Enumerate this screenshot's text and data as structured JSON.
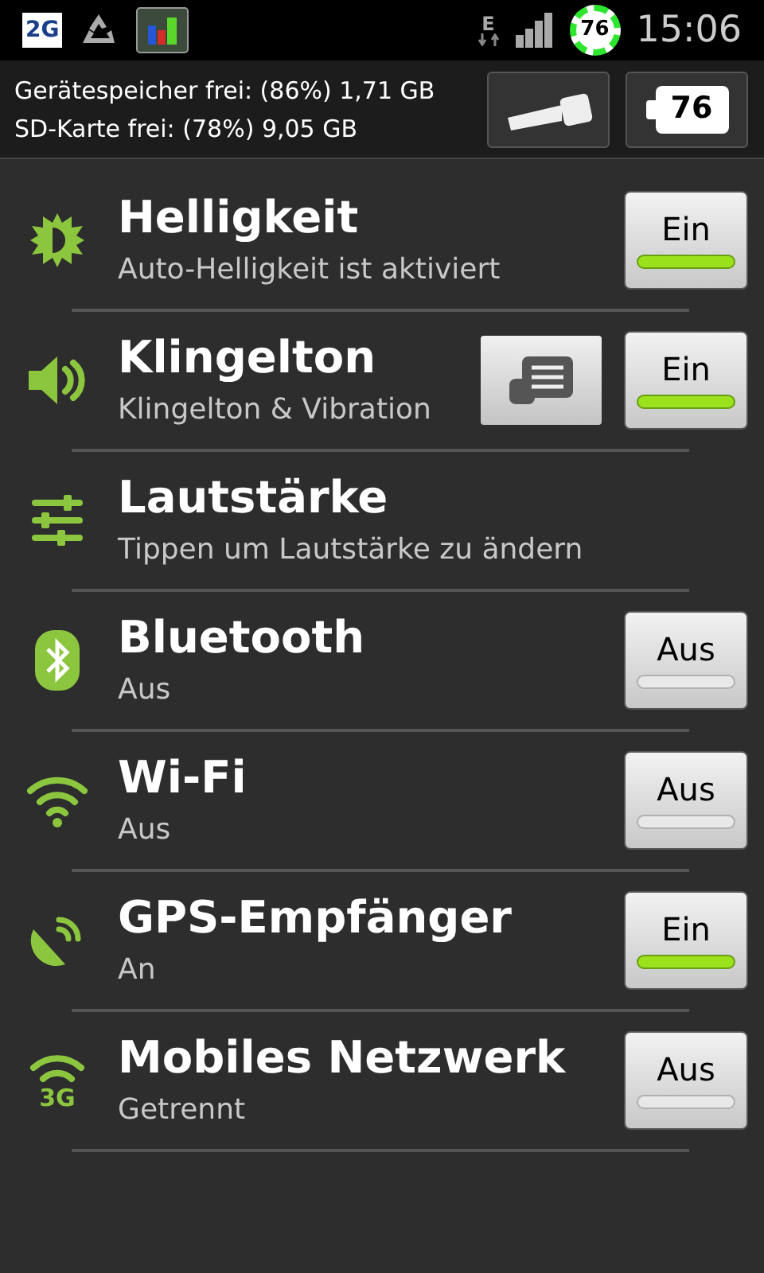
{
  "status_bar": {
    "network_badge": "2G",
    "data_type": "E",
    "battery_level": "76",
    "time": "15:06"
  },
  "header": {
    "storage_lines": [
      "Gerätespeicher frei: (86%) 1,71 GB",
      "SD-Karte frei: (78%) 9,05 GB"
    ],
    "battery_button": "76"
  },
  "settings": [
    {
      "kind": "brightness",
      "title": "Helligkeit",
      "subtitle": "Auto-Helligkeit ist aktiviert",
      "toggle": {
        "label": "Ein",
        "on": true
      }
    },
    {
      "kind": "speaker",
      "title": "Klingelton",
      "subtitle": "Klingelton & Vibration",
      "has_menu_button": true,
      "toggle": {
        "label": "Ein",
        "on": true
      }
    },
    {
      "kind": "sliders",
      "title": "Lautstärke",
      "subtitle": "Tippen um Lautstärke zu ändern"
    },
    {
      "kind": "bluetooth",
      "title": "Bluetooth",
      "subtitle": "Aus",
      "toggle": {
        "label": "Aus",
        "on": false
      }
    },
    {
      "kind": "wifi",
      "title": "Wi-Fi",
      "subtitle": "Aus",
      "toggle": {
        "label": "Aus",
        "on": false
      }
    },
    {
      "kind": "gps",
      "title": "GPS-Empfänger",
      "subtitle": "An",
      "toggle": {
        "label": "Ein",
        "on": true
      }
    },
    {
      "kind": "mobile",
      "icon_text": "3G",
      "title": "Mobiles Netzwerk",
      "subtitle": "Getrennt",
      "toggle": {
        "label": "Aus",
        "on": false
      }
    }
  ]
}
